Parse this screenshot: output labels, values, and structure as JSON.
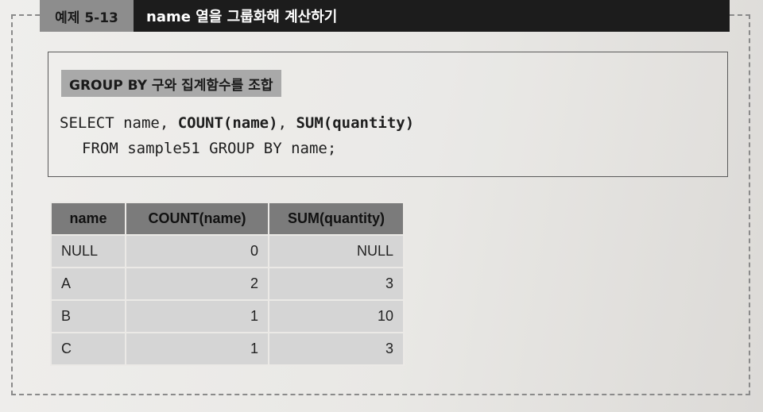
{
  "header": {
    "example_label": "예제 5-13",
    "title": "name 열을 그룹화해 계산하기"
  },
  "code_box": {
    "tag": "GROUP BY 구와 집계함수를 조합",
    "line1": {
      "kw1": "SELECT name, ",
      "b1": "COUNT(name)",
      "mid": ", ",
      "b2": "SUM(quantity)"
    },
    "line2": "FROM sample51 GROUP BY name;"
  },
  "result_table": {
    "headers": [
      "name",
      "COUNT(name)",
      "SUM(quantity)"
    ],
    "rows": [
      [
        "NULL",
        "0",
        "NULL"
      ],
      [
        "A",
        "2",
        "3"
      ],
      [
        "B",
        "1",
        "10"
      ],
      [
        "C",
        "1",
        "3"
      ]
    ]
  }
}
